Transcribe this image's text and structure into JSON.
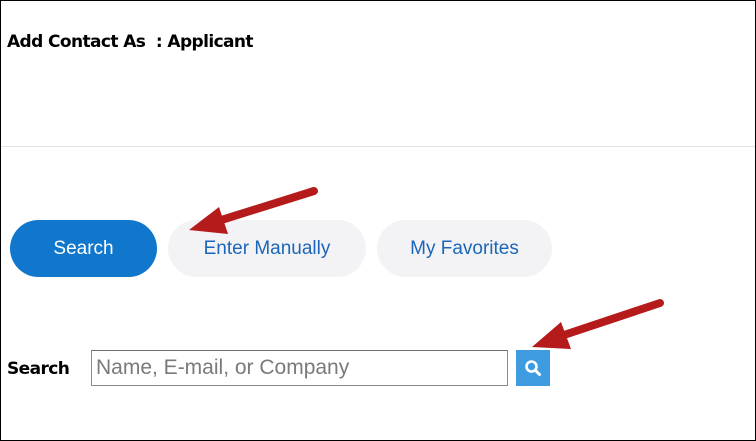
{
  "header": {
    "title": "Add Contact As  : Applicant"
  },
  "tabs": [
    {
      "label": "Search",
      "active": true
    },
    {
      "label": "Enter Manually",
      "active": false
    },
    {
      "label": "My Favorites",
      "active": false
    }
  ],
  "search": {
    "label": "Search",
    "placeholder": "Name, E-mail, or Company",
    "value": "",
    "button_icon": "search-icon"
  },
  "annotations": {
    "arrow_color": "#b51b1b",
    "arrow_icons": [
      "arrow-pointing-enter-manually",
      "arrow-pointing-search-button"
    ]
  },
  "colors": {
    "primary": "#1177cc",
    "tab_inactive_bg": "#f3f3f5",
    "tab_inactive_text": "#1b66b8",
    "search_button": "#3f9be0"
  }
}
